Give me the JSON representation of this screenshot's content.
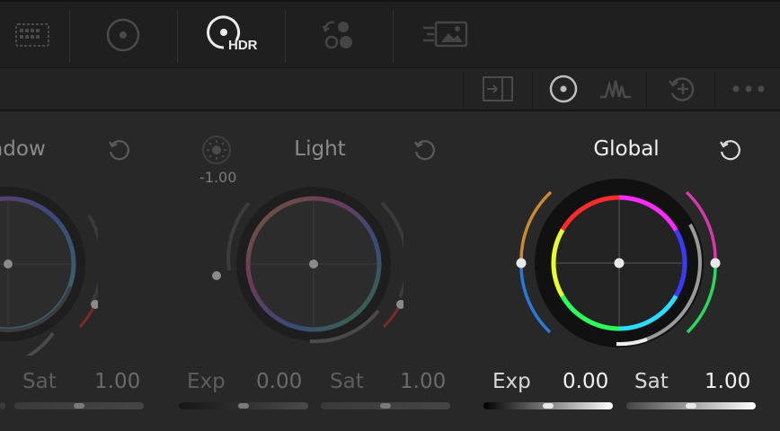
{
  "toolbar": {
    "tools": [
      {
        "name": "grid-tool",
        "icon": "grid-icon",
        "active": false
      },
      {
        "name": "primaries-tool",
        "icon": "color-wheel-icon",
        "active": false
      },
      {
        "name": "hdr-tool",
        "icon": "hdr-wheel-icon",
        "label": "HDR",
        "active": true
      },
      {
        "name": "rgb-mixer-tool",
        "icon": "rgb-mixer-icon",
        "active": false
      },
      {
        "name": "motion-effects-tool",
        "icon": "motion-effects-icon",
        "active": false
      }
    ]
  },
  "subbar": {
    "icons": [
      "panel-toggle-icon",
      "wheel-mode-icon",
      "curve-mode-icon",
      "add-zone-icon",
      "more-icon"
    ]
  },
  "wheels": [
    {
      "id": "shadow",
      "title": "adow",
      "exp_label": "",
      "exp_value": "",
      "sat_label": "Sat",
      "sat_value": "1.00",
      "active": false
    },
    {
      "id": "light",
      "title": "Light",
      "top_value": "-1.00",
      "exp_label": "Exp",
      "exp_value": "0.00",
      "sat_label": "Sat",
      "sat_value": "1.00",
      "active": false
    },
    {
      "id": "global",
      "title": "Global",
      "exp_label": "Exp",
      "exp_value": "0.00",
      "sat_label": "Sat",
      "sat_value": "1.00",
      "active": true
    }
  ],
  "colors": {
    "accent_active_text": "#f2f2f2",
    "inactive_text": "#8a8a8a",
    "toolbar_bg": "#1f1f1f",
    "panel_bg": "#282828"
  }
}
